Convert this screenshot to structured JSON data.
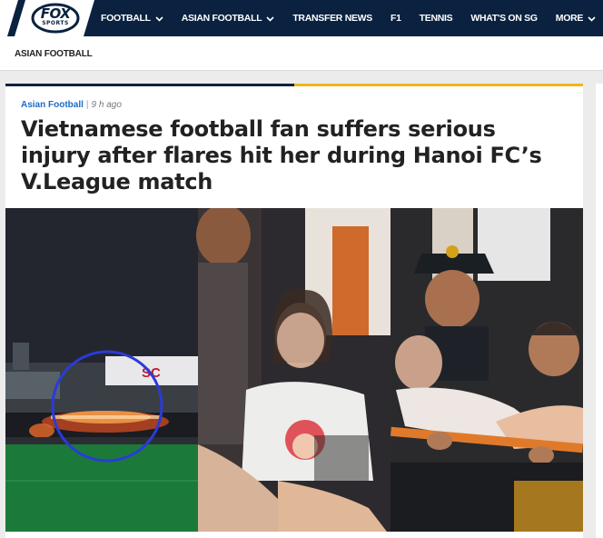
{
  "brand": {
    "logo_text": "FOX",
    "logo_sub": "SPORTS"
  },
  "nav": {
    "items": [
      {
        "label": "FOOTBALL",
        "has_dropdown": true
      },
      {
        "label": "ASIAN FOOTBALL",
        "has_dropdown": true
      },
      {
        "label": "TRANSFER NEWS",
        "has_dropdown": false
      },
      {
        "label": "F1",
        "has_dropdown": false
      },
      {
        "label": "TENNIS",
        "has_dropdown": false
      },
      {
        "label": "WHAT'S ON SG",
        "has_dropdown": false
      },
      {
        "label": "MORE",
        "has_dropdown": true
      }
    ]
  },
  "breadcrumb": {
    "label": "ASIAN FOOTBALL"
  },
  "article": {
    "category": "Asian Football",
    "separator": "|",
    "time": "9 h ago",
    "headline": "Vietnamese football fan suffers serious injury after flares hit her during Hanoi FC’s V.League match",
    "image_panel_1_sign": "SC"
  },
  "colors": {
    "nav_bg": "#0a2240",
    "accent_yellow": "#f2b616",
    "link_blue": "#1a6cc9"
  }
}
